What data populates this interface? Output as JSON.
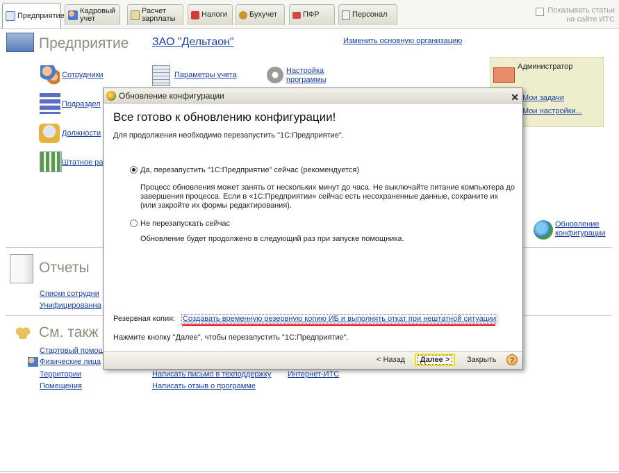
{
  "tabs": [
    {
      "label": "Предприятие",
      "active": true
    },
    {
      "label": "Кадровый учет",
      "active": false
    },
    {
      "label": "Расчет зарплаты",
      "active": false
    },
    {
      "label": "Налоги",
      "active": false
    },
    {
      "label": "Бухучет",
      "active": false
    },
    {
      "label": "ПФР",
      "active": false
    },
    {
      "label": "Персонал",
      "active": false
    }
  ],
  "show_its": "Показывать статьи на сайте ИТС",
  "enterprise": {
    "title": "Предприятие",
    "org_name": "ЗАО \"Дельтаон\"",
    "change_org": "Изменить основную организацию",
    "links": [
      "Сотрудники",
      "Подраздел",
      "Должности",
      "Штатное ра"
    ],
    "links2": [
      "Параметры учета",
      "Настройка программы"
    ]
  },
  "admin": {
    "name": "Администратор",
    "tasks": "Мои задачи",
    "settings": "Мои настройки..."
  },
  "update_link": "Обновление конфигурации",
  "reports": {
    "title": "Отчеты",
    "links": [
      "Списки сотрудни",
      "Унифицированна"
    ]
  },
  "see_also": {
    "title": "См. такж",
    "col1": [
      "Стартовый помощ",
      "Физические лица",
      "Территории",
      "Помещения"
    ],
    "col2": [
      "Написать письмо в техподдержку",
      "Написать отзыв о программе"
    ],
    "col3": [
      "Интернет-ИТС"
    ]
  },
  "dialog": {
    "title": "Обновление конфигурации",
    "heading": "Все готово к обновлению конфигурации!",
    "subtitle": "Для продолжения необходимо перезапустить \"1С:Предприятие\".",
    "option1": "Да, перезапустить \"1С:Предприятие\" сейчас (рекомендуется)",
    "option1_desc": "Процесс обновления может занять от нескольких минут до часа. Не выключайте питание компьютера до завершения процесса. Если в «1С:Предприятии» сейчас есть несохраненные данные, сохраните их (или закройте их формы редактирования).",
    "option2": "Не перезапускать сейчас",
    "option2_desc": "Обновление будет продолжено в следующий раз при запуске помощника.",
    "backup_label": "Резервная копия:",
    "backup_link": "Создавать временную резервную копию ИБ и выполнять откат при нештатной ситуации",
    "hint": "Нажмите кнопку \"Далее\", чтобы перезапустить \"1С:Предприятие\".",
    "back": "< Назад",
    "next": "Далее >",
    "close": "Закрыть",
    "help": "?"
  }
}
